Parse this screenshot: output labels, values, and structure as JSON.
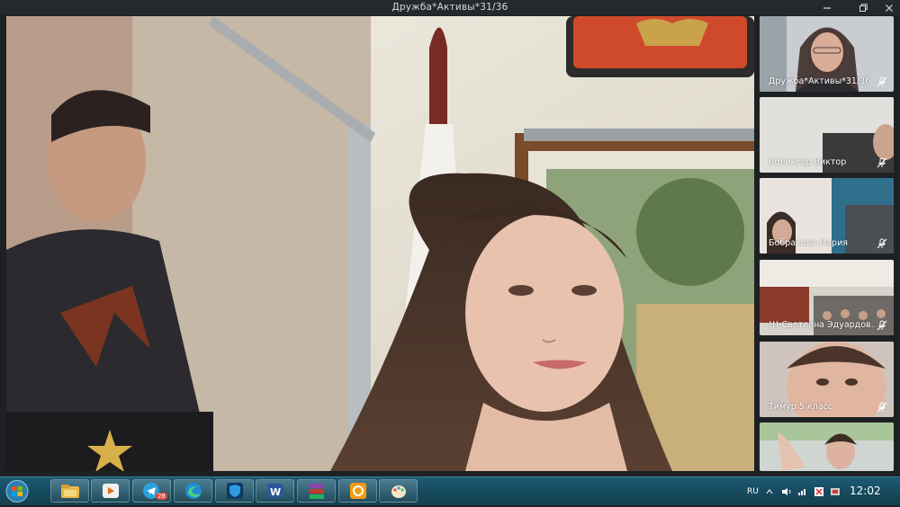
{
  "window": {
    "title": "Дружба*Активы*31/36",
    "controls": [
      "minimize-icon",
      "maximize-icon",
      "close-icon"
    ]
  },
  "participants": [
    {
      "name": "Дружба*Активы*31/36",
      "muted": true
    },
    {
      "name": "Великсар Виктор",
      "muted": true
    },
    {
      "name": "Бобракова Мария",
      "muted": true
    },
    {
      "name": "!!! Светлана Эдуардов...",
      "muted": true
    },
    {
      "name": "Тимур 5 класс",
      "muted": true
    },
    {
      "name": "",
      "muted": false
    }
  ],
  "taskbar": {
    "apps": [
      "explorer-icon",
      "media-player-icon",
      "telegram-icon",
      "edge-icon",
      "shield-app-icon",
      "word-icon",
      "winrar-icon",
      "orange-app-icon",
      "paint-icon"
    ],
    "telegram_badge": "28",
    "language": "RU",
    "time": "12:02"
  },
  "colors": {
    "titlebar": "#26292c",
    "taskbar": "#174b60",
    "mute_icon": "#ffffff"
  }
}
